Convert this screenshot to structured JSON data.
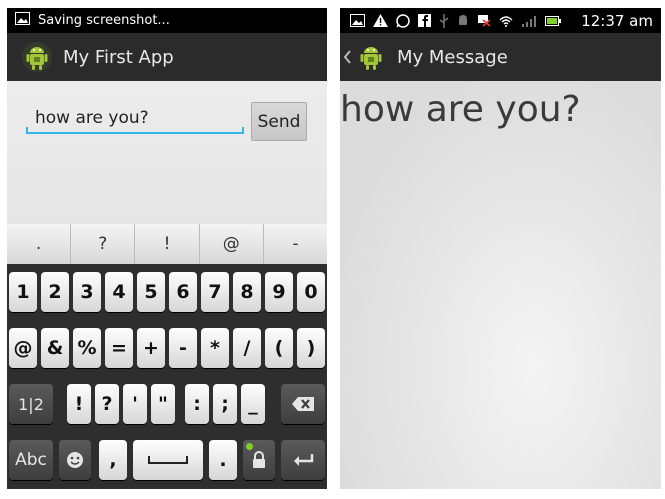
{
  "left": {
    "status": {
      "text": "Saving screenshot..."
    },
    "action_bar": {
      "title": "My First App"
    },
    "message_field": {
      "value": "how are you?"
    },
    "send_button": {
      "label": "Send"
    },
    "keyboard": {
      "suggestions": [
        ".",
        "?",
        "!",
        "@",
        "-"
      ],
      "row1": [
        "1",
        "2",
        "3",
        "4",
        "5",
        "6",
        "7",
        "8",
        "9",
        "0"
      ],
      "row2": [
        "@",
        "&",
        "%",
        "=",
        "+",
        "-",
        "*",
        "/",
        "(",
        ")"
      ],
      "row3": [
        "1|2",
        "!",
        "?",
        "'",
        "\"",
        ":",
        ";",
        "_"
      ],
      "row4": {
        "abc": "Abc",
        "comma": ",",
        "period": "."
      }
    }
  },
  "right": {
    "status": {
      "time": "12:37 am"
    },
    "action_bar": {
      "title": "My Message"
    },
    "message": "how are you?"
  },
  "colors": {
    "accent": "#33b5e5",
    "action_bar": "#2b2b2b",
    "android_green": "#a4c639"
  }
}
